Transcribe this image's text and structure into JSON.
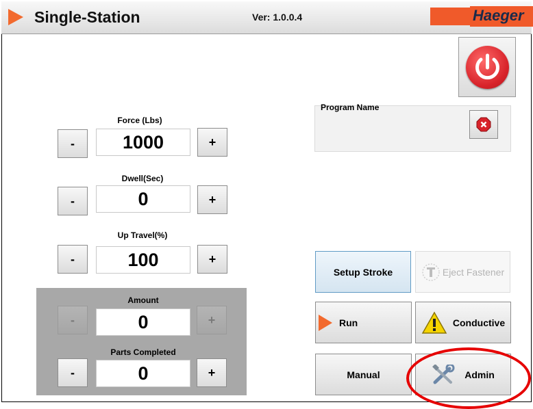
{
  "app": {
    "title": "Single-Station",
    "version": "Ver: 1.0.0.4",
    "brand": "Haeger"
  },
  "colors": {
    "accent": "#f26a2e",
    "power": "#d8232a",
    "highlight": "#e60000"
  },
  "settings": [
    {
      "label": "Force (Lbs)",
      "value": "1000",
      "minus": "-",
      "plus": "+"
    },
    {
      "label": "Dwell(Sec)",
      "value": "0",
      "minus": "-",
      "plus": "+"
    },
    {
      "label": "Up Travel(%)",
      "value": "100",
      "minus": "-",
      "plus": "+"
    }
  ],
  "counters": [
    {
      "label": "Amount",
      "value": "0",
      "minus": "-",
      "plus": "+",
      "disabled": true
    },
    {
      "label": "Parts Completed",
      "value": "0",
      "minus": "-",
      "plus": "+",
      "disabled": false
    }
  ],
  "program": {
    "label": "Program Name",
    "value": ""
  },
  "actions": {
    "setup_stroke": "Setup Stroke",
    "eject_fastener": "Eject Fastener",
    "run": "Run",
    "conductive": "Conductive",
    "manual": "Manual",
    "admin": "Admin"
  },
  "icons": [
    "power-icon",
    "clear-icon",
    "fastener-icon",
    "play-icon",
    "warning-icon",
    "tools-icon"
  ]
}
